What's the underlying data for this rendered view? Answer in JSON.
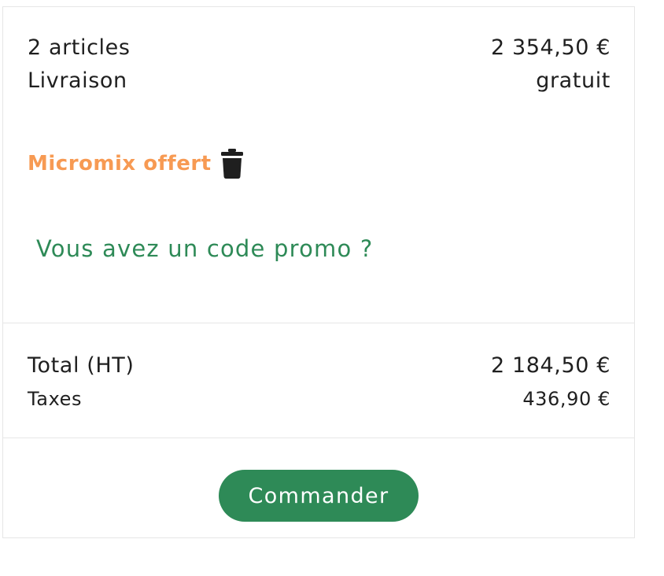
{
  "summary": {
    "items_label": "2 articles",
    "items_value": "2 354,50 €",
    "shipping_label": "Livraison",
    "shipping_value": "gratuit"
  },
  "gift": {
    "label": "Micromix offert",
    "remove_icon": "trash-icon"
  },
  "promo": {
    "link_label": "Vous avez un code promo ?"
  },
  "totals": {
    "total_label": "Total (HT)",
    "total_value": "2 184,50 €",
    "taxes_label": "Taxes",
    "taxes_value": "436,90 €"
  },
  "actions": {
    "order_label": "Commander"
  },
  "colors": {
    "accent_green": "#2e8a57",
    "gift_orange": "#f79a53",
    "text": "#1f1f1f",
    "border": "#e6e6e6"
  }
}
